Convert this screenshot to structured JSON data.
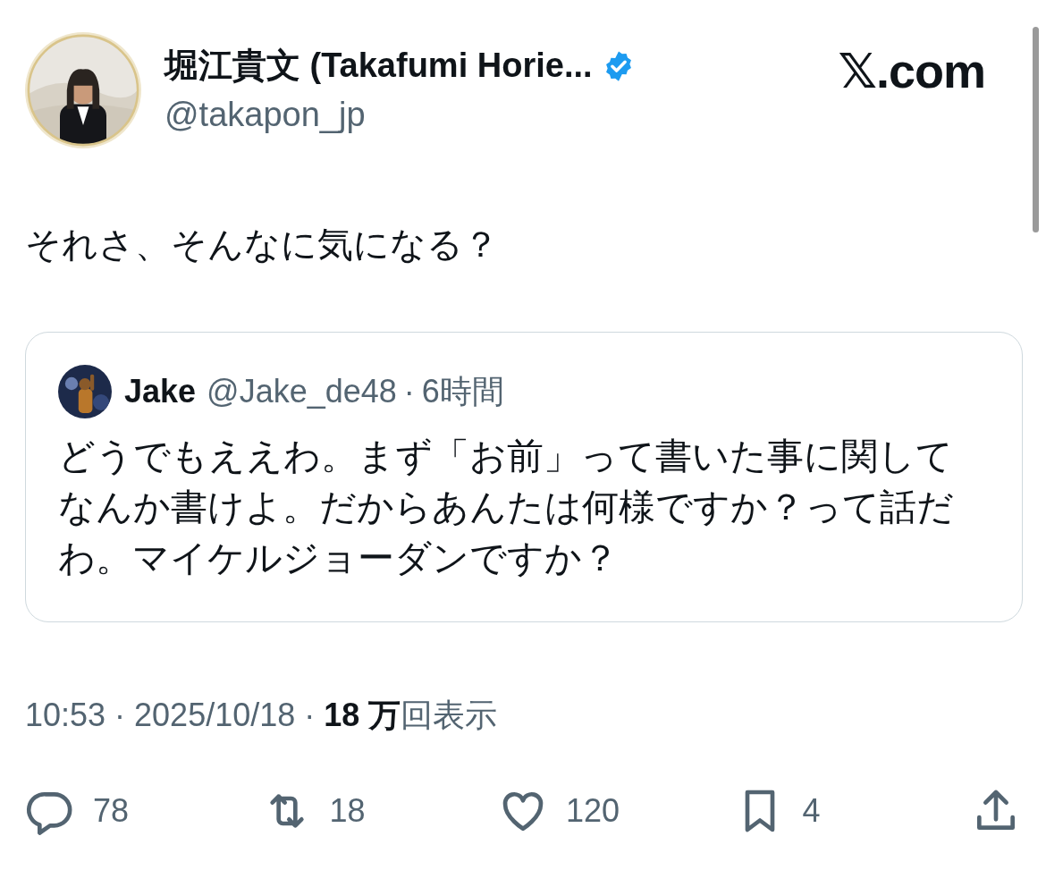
{
  "author": {
    "name": "堀江貴文 (Takafumi Horie...",
    "verified": true,
    "handle": "@takapon_jp"
  },
  "site": "𝕏.com",
  "text": "それさ、そんなに気になる？",
  "quote": {
    "name": "Jake",
    "handle": "@Jake_de48",
    "separator": "·",
    "time": "6時間",
    "text": "どうでもええわ。まず「お前」って書いた事に関してなんか書けよ。だからあんたは何様ですか？って話だわ。マイケルジョーダンですか？"
  },
  "meta": "10:53 · 2025/10/18 · **18 万**回表示",
  "actions": [
    {
      "kind": "reply",
      "count": "78"
    },
    {
      "kind": "repost",
      "count": "18"
    },
    {
      "kind": "like",
      "count": "120"
    },
    {
      "kind": "bookmark",
      "count": "4"
    },
    {
      "kind": "share"
    }
  ]
}
